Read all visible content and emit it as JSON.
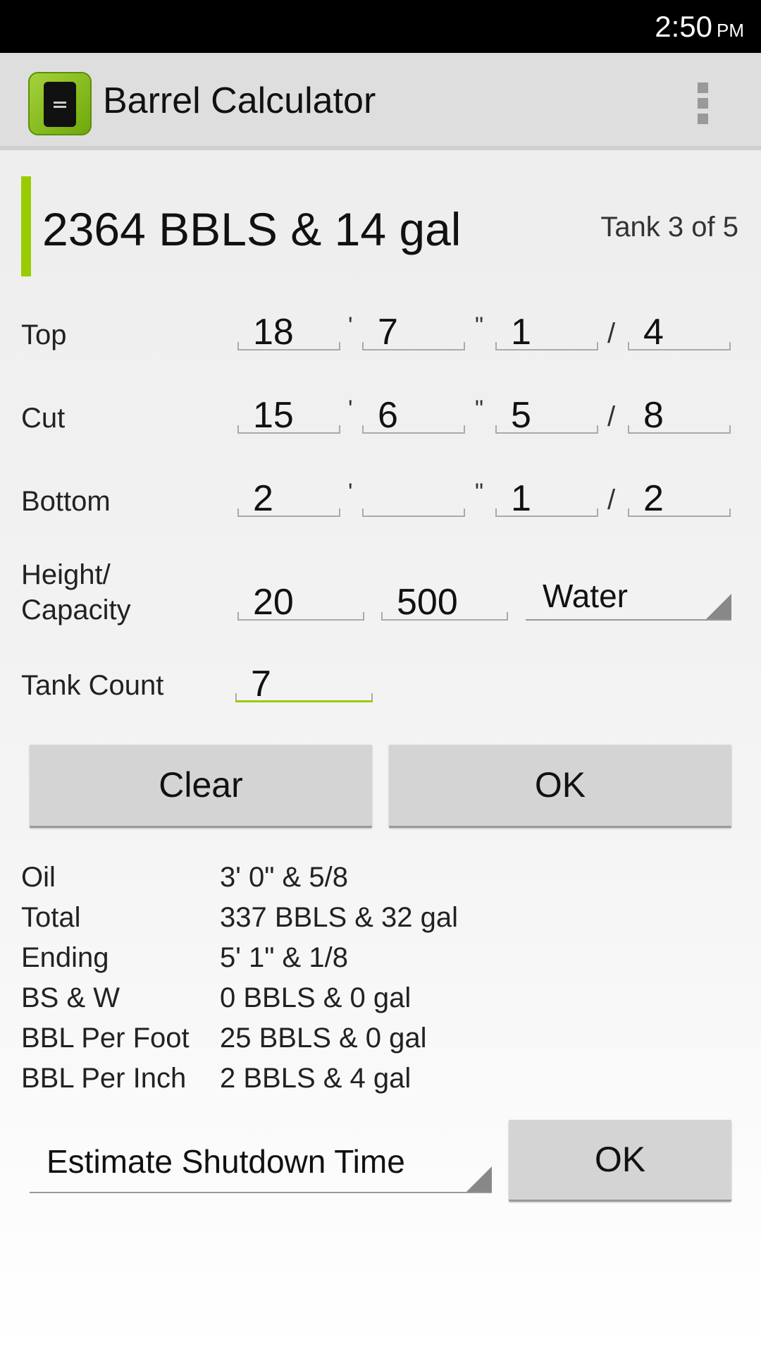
{
  "status_bar": {
    "time": "2:50",
    "ampm": "PM"
  },
  "action_bar": {
    "title": "Barrel Calculator",
    "app_icon": "barrel-icon",
    "overflow_icon": "more-vert-icon"
  },
  "summary": {
    "result": "2364 BBLS & 14 gal",
    "tank_index": "Tank 3 of 5",
    "accent_color": "#99cc00"
  },
  "measure_rows": [
    {
      "label": "Top",
      "feet": "18",
      "inches": "7",
      "num": "1",
      "den": "4"
    },
    {
      "label": "Cut",
      "feet": "15",
      "inches": "6",
      "num": "5",
      "den": "8"
    },
    {
      "label": "Bottom",
      "feet": "2",
      "inches": "",
      "num": "1",
      "den": "2"
    }
  ],
  "symbols": {
    "feet": "'",
    "inches": "\"",
    "slash": "/"
  },
  "height_capacity": {
    "label_line1": "Height/",
    "label_line2": "Capacity",
    "height": "20",
    "capacity": "500",
    "fluid": "Water"
  },
  "tank_count": {
    "label": "Tank Count",
    "value": "7"
  },
  "buttons": {
    "clear": "Clear",
    "ok": "OK",
    "ok2": "OK"
  },
  "results": [
    {
      "label": "Oil",
      "value": "3' 0\" & 5/8"
    },
    {
      "label": "Total",
      "value": "337 BBLS & 32 gal"
    },
    {
      "label": "Ending",
      "value": "5' 1\" & 1/8"
    },
    {
      "label": "BS & W",
      "value": "0 BBLS & 0 gal"
    },
    {
      "label": "BBL Per Foot",
      "value": "25 BBLS & 0 gal"
    },
    {
      "label": "BBL Per Inch",
      "value": "2 BBLS & 4 gal"
    }
  ],
  "estimate": {
    "selected": "Estimate Shutdown Time"
  }
}
